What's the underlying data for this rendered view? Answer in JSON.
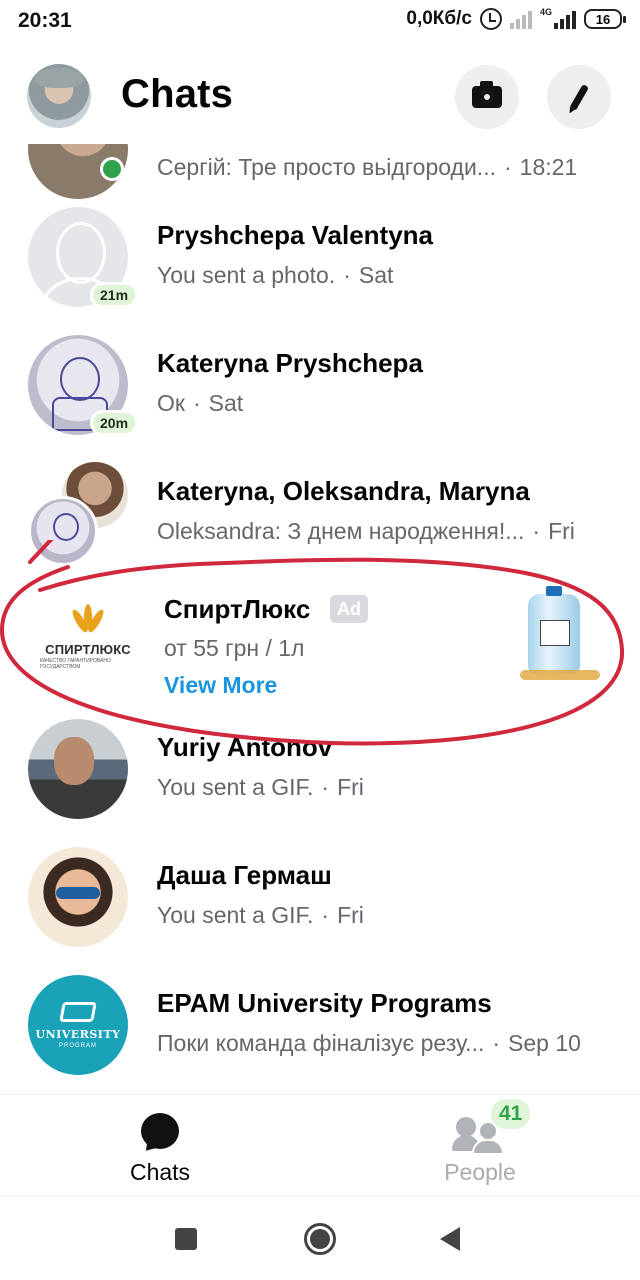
{
  "status_bar": {
    "time": "20:31",
    "net_speed": "0,0Кб/с",
    "network_type": "4G",
    "battery": "16"
  },
  "header": {
    "title": "Chats",
    "camera_icon": "camera-icon",
    "compose_icon": "pencil-icon"
  },
  "chats": [
    {
      "name": "",
      "preview": "Сергій: Тре просто вьідгороди...",
      "time": "18:21",
      "online": true
    },
    {
      "name": "Pryshchepa Valentyna",
      "preview": "You sent a photo.",
      "time": "Sat",
      "badge": "21m"
    },
    {
      "name": "Kateryna Pryshchepa",
      "preview": "Ок",
      "time": "Sat",
      "badge": "20m"
    },
    {
      "name": "Kateryna, Oleksandra, Maryna",
      "preview": "Oleksandra: З днем народження!...",
      "time": "Fri"
    },
    {
      "name": "Yuriy Antonov",
      "preview": "You sent a GIF.",
      "time": "Fri"
    },
    {
      "name": "Даша Гермаш",
      "preview": "You sent a GIF.",
      "time": "Fri"
    },
    {
      "name": "EPAM University Programs",
      "preview": "Поки команда фіналізує резу...",
      "time": "Sep 10"
    }
  ],
  "ad": {
    "name": "СпиртЛюкс",
    "badge": "Ad",
    "description": "от 55 грн / 1л",
    "link": "View More",
    "logo_text": "СПИРТЛЮКС",
    "logo_subtext": "КАЧЕСТВО ГАРАНТИРОВАНО ГОСУДАРСТВОМ"
  },
  "epam_avatar": {
    "text": "UNIVERSITY",
    "subtext": "PROGRAM"
  },
  "bottom_nav": {
    "chats_label": "Chats",
    "people_label": "People",
    "people_count": "41"
  },
  "colors": {
    "accent_link": "#1b95e0",
    "online": "#31a24c",
    "annotation": "#d0283c"
  }
}
